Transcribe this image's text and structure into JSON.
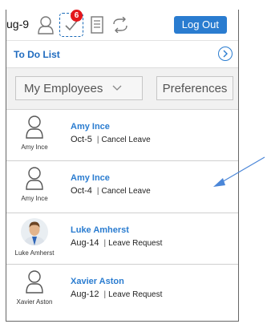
{
  "header": {
    "user_short": "ug-9",
    "tasks_badge_count": "6",
    "logout_label": "Log Out"
  },
  "todo": {
    "title": "To Do List"
  },
  "filters": {
    "employees_selected": "My Employees",
    "preferences_label": "Preferences"
  },
  "items": [
    {
      "avatar_caption": "Amy Ince",
      "name": "Amy Ince",
      "date": "Oct-5",
      "type": "Cancel Leave",
      "avatar": "person-outline-icon"
    },
    {
      "avatar_caption": "Amy Ince",
      "name": "Amy Ince",
      "date": "Oct-4",
      "type": "Cancel Leave",
      "avatar": "person-outline-icon"
    },
    {
      "avatar_caption": "Luke Amherst",
      "name": "Luke Amherst",
      "date": "Aug-14",
      "type": "Leave Request",
      "avatar": "photo"
    },
    {
      "avatar_caption": "Xavier Aston",
      "name": "Xavier Aston",
      "date": "Aug-12",
      "type": "Leave Request",
      "avatar": "person-outline-icon"
    }
  ],
  "colors": {
    "accent_blue": "#2a7cd0",
    "badge_red": "#e3161c",
    "annotation_arrow": "#4a86d8"
  }
}
